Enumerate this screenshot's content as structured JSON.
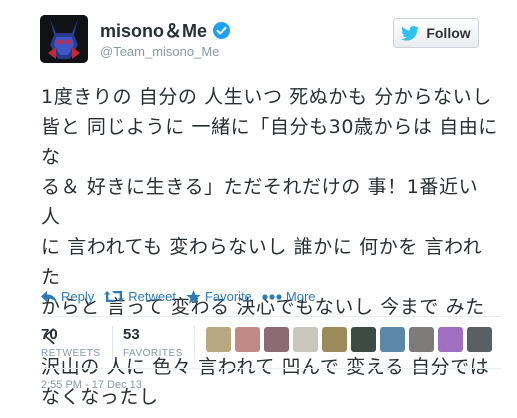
{
  "user": {
    "full_name": "misono＆Me",
    "handle": "@Team_misono_Me"
  },
  "follow": {
    "label": "Follow"
  },
  "tweet": {
    "lines": [
      "1度きりの 自分の 人生いつ 死ぬかも 分からないし",
      "皆と 同じように 一緒に「自分も30歳からは 自由にな",
      "る＆ 好きに生きる」ただそれだけの 事！1番近い 人",
      "に 言われても 変わらないし 誰かに 何かを 言われた",
      "からと 言って 変わる 決心でもないし 今まで みたく",
      "沢山の 人に 色々 言われて 凹んで 変える 自分では",
      "なくなったし"
    ]
  },
  "actions": {
    "reply": "Reply",
    "retweet": "Retweet",
    "favorite": "Favorite",
    "more": "More"
  },
  "stats": {
    "retweets_count": "70",
    "retweets_label": "RETWEETS",
    "favorites_count": "53",
    "favorites_label": "FAVORITES"
  },
  "favoriters": [
    {
      "color": "#b9a77f"
    },
    {
      "color": "#c08a85"
    },
    {
      "color": "#8c6a74"
    },
    {
      "color": "#c9c6bd"
    },
    {
      "color": "#9b8a5a"
    },
    {
      "color": "#3c4a44"
    },
    {
      "color": "#5b88a9"
    },
    {
      "color": "#7e7c7a"
    },
    {
      "color": "#a06fc0"
    },
    {
      "color": "#595f64"
    }
  ],
  "timestamp": "2:55 PM - 17 Dec 13",
  "colors": {
    "link_blue": "#2b7bb9",
    "verified_blue": "#1da1f2",
    "twitter_bird": "#2fc2ef"
  }
}
